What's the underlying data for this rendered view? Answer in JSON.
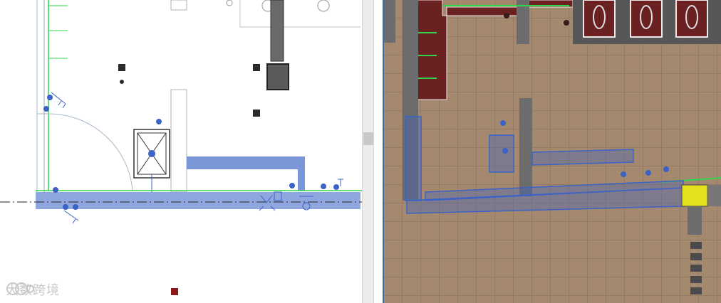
{
  "window": {
    "title": ""
  },
  "views": [
    {
      "name": "floor-plan-view",
      "kind": "2D plan"
    },
    {
      "name": "3d-view",
      "kind": "3D perspective"
    }
  ],
  "watermark": {
    "text": "大数跨境"
  },
  "colors": {
    "pipe_highlight": "#7b97d8",
    "pipe_outline": "#3b62c6",
    "wall_green": "#2fd64a",
    "floor_tile": "#a4896e",
    "grout": "#877058",
    "maroon": "#6b2121",
    "yellow_block": "#e3e01e",
    "fixture_grey": "#6c6c6c"
  },
  "icons": [
    "fixture-tag-icon",
    "floor-drain-icon",
    "duct-riser-icon"
  ]
}
